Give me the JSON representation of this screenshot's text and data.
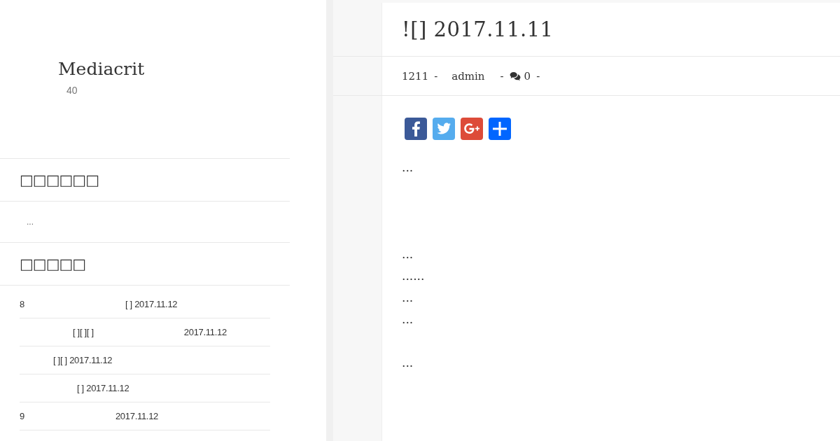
{
  "site": {
    "title": "Mediacrit",
    "tagline": "40"
  },
  "widgets": [
    {
      "title": "□□□□□□",
      "kind": "text",
      "text": "..."
    },
    {
      "title": "□□□□□",
      "kind": "list",
      "items": [
        {
          "parts": [
            "8",
            "[ ] 2017.11.12"
          ]
        },
        {
          "parts": [
            "[ ][ ][ ]",
            "2017.11.12"
          ]
        },
        {
          "parts": [
            "[ ][ ] 2017.11.12"
          ]
        },
        {
          "parts": [
            "[ ] 2017.11.12"
          ]
        },
        {
          "parts": [
            "9",
            "2017.11.12"
          ]
        }
      ]
    }
  ],
  "post": {
    "title": "![] 2017.11.11",
    "meta": {
      "views": "1211",
      "author": "admin",
      "comments": "0",
      "separators": [
        "-",
        "-",
        "-"
      ]
    },
    "share": [
      {
        "kind": "facebook"
      },
      {
        "kind": "twitter"
      },
      {
        "kind": "googleplus"
      },
      {
        "kind": "more"
      }
    ],
    "blocks": [
      {
        "lines": [
          "..."
        ]
      },
      {
        "lines": [
          "...",
          "......",
          "...",
          "..."
        ]
      },
      {
        "lines": [
          "..."
        ]
      }
    ]
  }
}
